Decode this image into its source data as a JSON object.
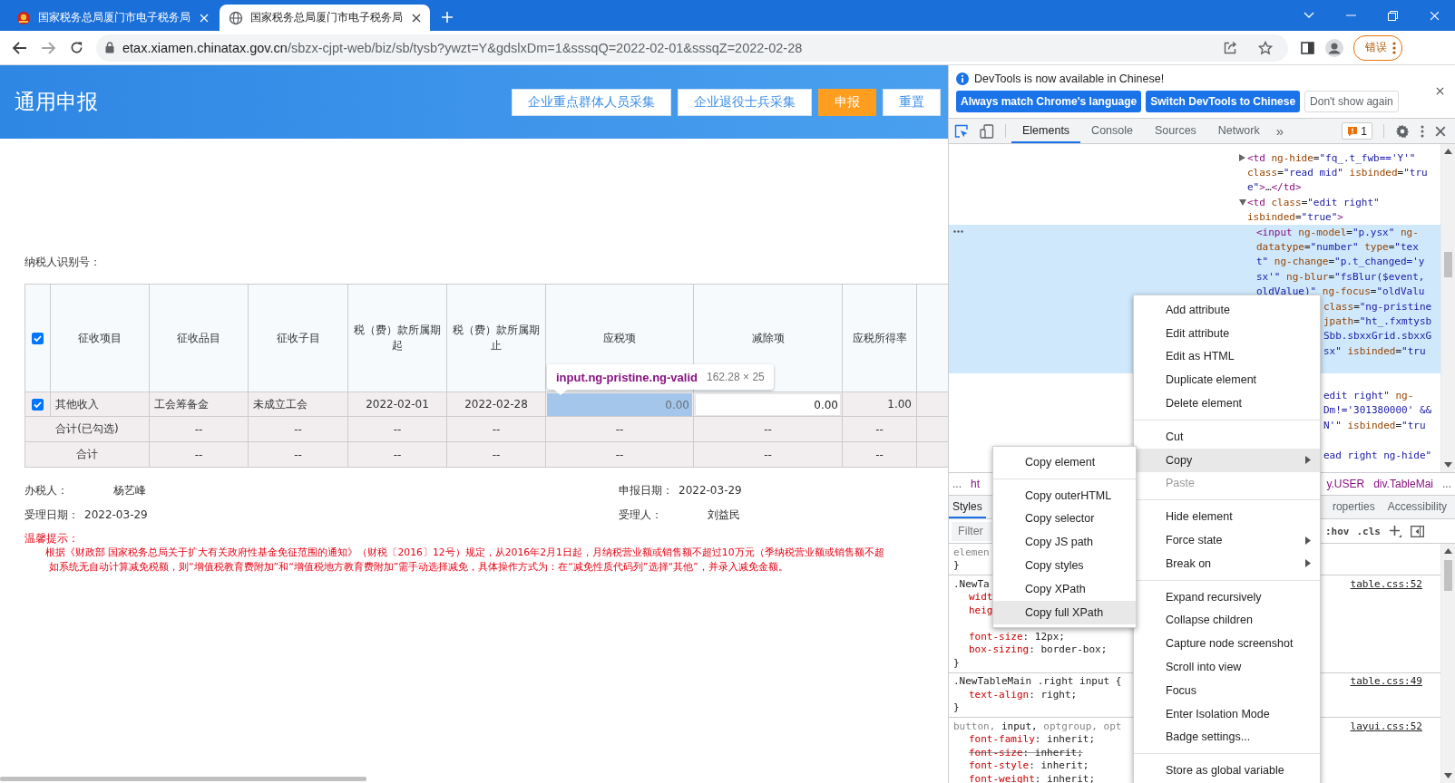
{
  "browser": {
    "tabs": [
      {
        "title": "国家税务总局厦门市电子税务局",
        "selected": false
      },
      {
        "title": "国家税务总局厦门市电子税务局",
        "selected": true
      }
    ],
    "url": {
      "host": "etax.xiamen.chinatax.gov.cn",
      "path": "/sbzx-cjpt-web/biz/sb/tysb?ywzt=Y&gdslxDm=1&sssqQ=2022-02-01&sssqZ=2022-02-28"
    },
    "error_button": "错误"
  },
  "page": {
    "title": "通用申报",
    "actions": [
      {
        "label": "企业重点群体人员采集",
        "kind": "outline"
      },
      {
        "label": "企业退役士兵采集",
        "kind": "outline"
      },
      {
        "label": "申报",
        "kind": "primary"
      },
      {
        "label": "重置",
        "kind": "outline"
      }
    ],
    "taxpayer_label": "纳税人识别号：",
    "table": {
      "select_all": {
        "checked": true
      },
      "columns": [
        "征收项目",
        "征收品目",
        "征收子目",
        "税（费）款所属期起",
        "税（费）款所属期止",
        "应税项",
        "减除项",
        "应税所得率"
      ],
      "rows": [
        {
          "kind": "item",
          "checked": true,
          "cells": [
            {
              "kind": "text",
              "text": "其他收入"
            },
            {
              "kind": "text",
              "text": "工会筹备金"
            },
            {
              "kind": "text",
              "text": "未成立工会"
            },
            {
              "kind": "date",
              "text": "2022-02-01"
            },
            {
              "kind": "date",
              "text": "2022-02-28"
            },
            {
              "kind": "input",
              "text": "0.00",
              "inspected": true
            },
            {
              "kind": "input",
              "text": "0.00",
              "inspected": false
            },
            {
              "kind": "number",
              "text": "1.00"
            }
          ]
        },
        {
          "kind": "total",
          "label": "合计(已勾选)",
          "cells": [
            "--",
            "--",
            "--",
            "--",
            "--",
            "--",
            "--"
          ]
        },
        {
          "kind": "total",
          "label": "合计",
          "cells": [
            "--",
            "--",
            "--",
            "--",
            "--",
            "--",
            "--"
          ]
        }
      ]
    },
    "inspect_tooltip": {
      "selector": "input.ng-pristine.ng-valid",
      "size": "162.28 × 25"
    },
    "fields": [
      {
        "kind": "person",
        "label": "办税人：",
        "value": "杨艺峰"
      },
      {
        "kind": "date",
        "label": "申报日期：",
        "value": "2022-03-29"
      },
      {
        "kind": "date",
        "label": "受理日期：",
        "value": "2022-03-29"
      },
      {
        "kind": "person",
        "label": "受理人：",
        "value": "刘益民"
      }
    ],
    "notice": {
      "title": "温馨提示：",
      "lines": [
        "根据《财政部 国家税务总局关于扩大有关政府性基金免征范围的通知》（财税〔2016〕12号）规定，从2016年2月1日起，月纳税营业额或销售额不超过10万元（季纳税营业额或销售额不超",
        "如系统无自动计算减免税额，则“增值税教育费附加”和“增值税地方教育费附加”需手动选择减免，具体操作方式为：在“减免性质代码列”选择“其他”，并录入减免金额。"
      ]
    }
  },
  "devtools": {
    "infobar": {
      "message": "DevTools is now available in Chinese!",
      "buttons": [
        {
          "label": "Always match Chrome's language",
          "kind": "primary"
        },
        {
          "label": "Switch DevTools to Chinese",
          "kind": "primary"
        },
        {
          "label": "Don't show again",
          "kind": "secondary"
        }
      ]
    },
    "tabs": [
      {
        "label": "Elements",
        "selected": true
      },
      {
        "label": "Console",
        "selected": false
      },
      {
        "label": "Sources",
        "selected": false
      },
      {
        "label": "Network",
        "selected": false
      }
    ],
    "more_tabs": "»",
    "issues_count": "1",
    "dom_lines": [
      {
        "kind": "full",
        "selected": false,
        "expanded": false,
        "parts": [
          {
            "kind": "tag",
            "text": "<td"
          },
          {
            "kind": "attr",
            "text": " ng-hide"
          },
          {
            "kind": "punct",
            "text": "="
          },
          {
            "kind": "value",
            "text": "\"fq_.t_fwb=='Y'\""
          }
        ]
      },
      {
        "kind": "full",
        "selected": false,
        "parts": [
          {
            "kind": "attr",
            "text": "class"
          },
          {
            "kind": "punct",
            "text": "="
          },
          {
            "kind": "value",
            "text": "\"read mid\""
          },
          {
            "kind": "attr",
            "text": " isbinded"
          },
          {
            "kind": "punct",
            "text": "="
          },
          {
            "kind": "value",
            "text": "\"tru"
          }
        ]
      },
      {
        "kind": "full",
        "selected": false,
        "parts": [
          {
            "kind": "value",
            "text": "e\""
          },
          {
            "kind": "tag",
            "text": ">"
          },
          {
            "kind": "punct",
            "text": "…"
          },
          {
            "kind": "tag",
            "text": "</td>"
          }
        ]
      },
      {
        "kind": "full",
        "selected": false,
        "expanded": true,
        "parts": [
          {
            "kind": "tag",
            "text": "<td"
          },
          {
            "kind": "attr",
            "text": " class"
          },
          {
            "kind": "punct",
            "text": "="
          },
          {
            "kind": "value",
            "text": "\"edit right\""
          }
        ]
      },
      {
        "kind": "full",
        "selected": false,
        "parts": [
          {
            "kind": "attr",
            "text": "isbinded"
          },
          {
            "kind": "punct",
            "text": "="
          },
          {
            "kind": "value",
            "text": "\"true\""
          },
          {
            "kind": "tag",
            "text": ">"
          }
        ]
      },
      {
        "kind": "child",
        "selected": true,
        "parts": [
          {
            "kind": "tag",
            "text": "<input"
          },
          {
            "kind": "attr",
            "text": " ng-model"
          },
          {
            "kind": "punct",
            "text": "="
          },
          {
            "kind": "value",
            "text": "\"p.ysx\""
          },
          {
            "kind": "attr",
            "text": " ng-"
          }
        ]
      },
      {
        "kind": "child",
        "selected": true,
        "parts": [
          {
            "kind": "attr",
            "text": "datatype"
          },
          {
            "kind": "punct",
            "text": "="
          },
          {
            "kind": "value",
            "text": "\"number\""
          },
          {
            "kind": "attr",
            "text": " type"
          },
          {
            "kind": "punct",
            "text": "="
          },
          {
            "kind": "value",
            "text": "\"tex"
          }
        ]
      },
      {
        "kind": "child",
        "selected": true,
        "parts": [
          {
            "kind": "value",
            "text": "t\""
          },
          {
            "kind": "attr",
            "text": " ng-change"
          },
          {
            "kind": "punct",
            "text": "="
          },
          {
            "kind": "value",
            "text": "\"p.t_changed='y"
          }
        ]
      },
      {
        "kind": "child",
        "selected": true,
        "parts": [
          {
            "kind": "value",
            "text": "sx'\""
          },
          {
            "kind": "attr",
            "text": " ng-blur"
          },
          {
            "kind": "punct",
            "text": "="
          },
          {
            "kind": "value",
            "text": "\"fsBlur($event,"
          }
        ]
      },
      {
        "kind": "child",
        "selected": true,
        "parts": [
          {
            "kind": "value",
            "text": "oldValue)\""
          },
          {
            "kind": "attr",
            "text": " ng-focus"
          },
          {
            "kind": "punct",
            "text": "="
          },
          {
            "kind": "value",
            "text": "\"oldValu"
          }
        ]
      },
      {
        "kind": "partial",
        "selected": true,
        "parts": [
          {
            "kind": "attr",
            "text": "class"
          },
          {
            "kind": "punct",
            "text": "="
          },
          {
            "kind": "value",
            "text": "\"ng-pristine"
          }
        ]
      },
      {
        "kind": "partial",
        "selected": true,
        "parts": [
          {
            "kind": "attr",
            "text": "jpath"
          },
          {
            "kind": "punct",
            "text": "="
          },
          {
            "kind": "value",
            "text": "\"ht_.fxmtysb"
          }
        ]
      },
      {
        "kind": "partial",
        "selected": true,
        "parts": [
          {
            "kind": "value",
            "text": "Sbb.sbxxGrid.sbxxG"
          }
        ]
      },
      {
        "kind": "partial",
        "selected": true,
        "parts": [
          {
            "kind": "value",
            "text": "sx\""
          },
          {
            "kind": "attr",
            "text": " isbinded"
          },
          {
            "kind": "punct",
            "text": "="
          },
          {
            "kind": "value",
            "text": "\"tru"
          }
        ]
      },
      {
        "kind": "hidden",
        "selected": true
      },
      {
        "kind": "hidden",
        "selected": false
      },
      {
        "kind": "partial",
        "selected": false,
        "parts": [
          {
            "kind": "value",
            "text": "edit right\""
          },
          {
            "kind": "attr",
            "text": " ng-"
          }
        ]
      },
      {
        "kind": "partial",
        "selected": false,
        "parts": [
          {
            "kind": "value",
            "text": "Dm!='301380000' &&"
          }
        ]
      },
      {
        "kind": "partial",
        "selected": false,
        "parts": [
          {
            "kind": "value",
            "text": "N'\""
          },
          {
            "kind": "attr",
            "text": " isbinded"
          },
          {
            "kind": "punct",
            "text": "="
          },
          {
            "kind": "value",
            "text": "\"tru"
          }
        ]
      },
      {
        "kind": "hidden",
        "selected": false
      },
      {
        "kind": "partial",
        "selected": false,
        "parts": [
          {
            "kind": "value",
            "text": "ead right ng-hide\""
          }
        ]
      }
    ],
    "breadcrumbs": [
      {
        "kind": "more",
        "text": "..."
      },
      {
        "kind": "node",
        "text": "ht"
      },
      {
        "kind": "node",
        "text": "y.USER"
      },
      {
        "kind": "node",
        "text": "div.TableMai"
      },
      {
        "kind": "more",
        "text": "..."
      }
    ],
    "side_tabs": [
      {
        "label": "Styles",
        "selected": true
      },
      {
        "label": "roperties",
        "selected": false
      },
      {
        "label": "Accessibility",
        "selected": false
      }
    ],
    "filter_placeholder": "Filter",
    "style_toggles": [
      ":hov",
      ".cls"
    ],
    "style_lines": [
      {
        "kind": "selector",
        "parts": [
          {
            "kind": "dim",
            "text": "elemen"
          }
        ]
      },
      {
        "kind": "brace",
        "text": "}"
      },
      {
        "kind": "divider"
      },
      {
        "kind": "selector",
        "parts": [
          {
            "kind": "match",
            "text": ".NewTa"
          }
        ],
        "source": "table.css:52"
      },
      {
        "kind": "prop",
        "name": "widt",
        "struck": false
      },
      {
        "kind": "prop",
        "name": "heig",
        "struck": false
      },
      {
        "kind": "blank"
      },
      {
        "kind": "prop",
        "name": "font-size",
        "value": ": 12px;",
        "struck": false
      },
      {
        "kind": "prop",
        "name": "box-sizing",
        "value": ": border-box;",
        "struck": false
      },
      {
        "kind": "brace",
        "text": "}"
      },
      {
        "kind": "divider"
      },
      {
        "kind": "selector",
        "parts": [
          {
            "kind": "match",
            "text": ".NewTableMain .right input {"
          }
        ],
        "source": "table.css:49"
      },
      {
        "kind": "prop",
        "name": "text-align",
        "value": ": right;",
        "struck": false
      },
      {
        "kind": "brace",
        "text": "}"
      },
      {
        "kind": "divider"
      },
      {
        "kind": "selector",
        "parts": [
          {
            "kind": "dim",
            "text": "button,"
          },
          {
            "kind": "match",
            "text": " input,"
          },
          {
            "kind": "dim",
            "text": " optgroup, opt"
          }
        ],
        "source": "layui.css:52"
      },
      {
        "kind": "prop",
        "name": "font-family",
        "value": ": inherit;",
        "struck": false
      },
      {
        "kind": "prop",
        "name": "font-size",
        "value": ": inherit;",
        "struck": true
      },
      {
        "kind": "prop",
        "name": "font-style",
        "value": ": inherit;",
        "struck": false
      },
      {
        "kind": "prop",
        "name": "font-weight",
        "value": ": inherit;",
        "struck": false
      }
    ],
    "context_menu": [
      {
        "kind": "item",
        "label": "Add attribute",
        "selected": false,
        "disabled": false,
        "submenu": false
      },
      {
        "kind": "item",
        "label": "Edit attribute",
        "selected": false,
        "disabled": false,
        "submenu": false
      },
      {
        "kind": "item",
        "label": "Edit as HTML",
        "selected": false,
        "disabled": false,
        "submenu": false
      },
      {
        "kind": "item",
        "label": "Duplicate element",
        "selected": false,
        "disabled": false,
        "submenu": false
      },
      {
        "kind": "item",
        "label": "Delete element",
        "selected": false,
        "disabled": false,
        "submenu": false
      },
      {
        "kind": "separator"
      },
      {
        "kind": "item",
        "label": "Cut",
        "selected": false,
        "disabled": false,
        "submenu": false
      },
      {
        "kind": "item",
        "label": "Copy",
        "selected": true,
        "disabled": false,
        "submenu": true
      },
      {
        "kind": "item",
        "label": "Paste",
        "selected": false,
        "disabled": true,
        "submenu": false
      },
      {
        "kind": "separator"
      },
      {
        "kind": "item",
        "label": "Hide element",
        "selected": false,
        "disabled": false,
        "submenu": false
      },
      {
        "kind": "item",
        "label": "Force state",
        "selected": false,
        "disabled": false,
        "submenu": true
      },
      {
        "kind": "item",
        "label": "Break on",
        "selected": false,
        "disabled": false,
        "submenu": true
      },
      {
        "kind": "separator"
      },
      {
        "kind": "item",
        "label": "Expand recursively",
        "selected": false,
        "disabled": false,
        "submenu": false
      },
      {
        "kind": "item",
        "label": "Collapse children",
        "selected": false,
        "disabled": false,
        "submenu": false
      },
      {
        "kind": "item",
        "label": "Capture node screenshot",
        "selected": false,
        "disabled": false,
        "submenu": false
      },
      {
        "kind": "item",
        "label": "Scroll into view",
        "selected": false,
        "disabled": false,
        "submenu": false
      },
      {
        "kind": "item",
        "label": "Focus",
        "selected": false,
        "disabled": false,
        "submenu": false
      },
      {
        "kind": "item",
        "label": "Enter Isolation Mode",
        "selected": false,
        "disabled": false,
        "submenu": false
      },
      {
        "kind": "item",
        "label": "Badge settings...",
        "selected": false,
        "disabled": false,
        "submenu": false
      },
      {
        "kind": "separator"
      },
      {
        "kind": "item",
        "label": "Store as global variable",
        "selected": false,
        "disabled": false,
        "submenu": false
      }
    ],
    "copy_submenu": [
      {
        "kind": "item",
        "label": "Copy element",
        "selected": false,
        "disabled": false,
        "submenu": false
      },
      {
        "kind": "separator"
      },
      {
        "kind": "item",
        "label": "Copy outerHTML",
        "selected": false,
        "disabled": false,
        "submenu": false
      },
      {
        "kind": "item",
        "label": "Copy selector",
        "selected": false,
        "disabled": false,
        "submenu": false
      },
      {
        "kind": "item",
        "label": "Copy JS path",
        "selected": false,
        "disabled": false,
        "submenu": false
      },
      {
        "kind": "item",
        "label": "Copy styles",
        "selected": false,
        "disabled": false,
        "submenu": false
      },
      {
        "kind": "item",
        "label": "Copy XPath",
        "selected": false,
        "disabled": false,
        "submenu": false
      },
      {
        "kind": "item",
        "label": "Copy full XPath",
        "selected": true,
        "disabled": false,
        "submenu": false
      }
    ]
  }
}
